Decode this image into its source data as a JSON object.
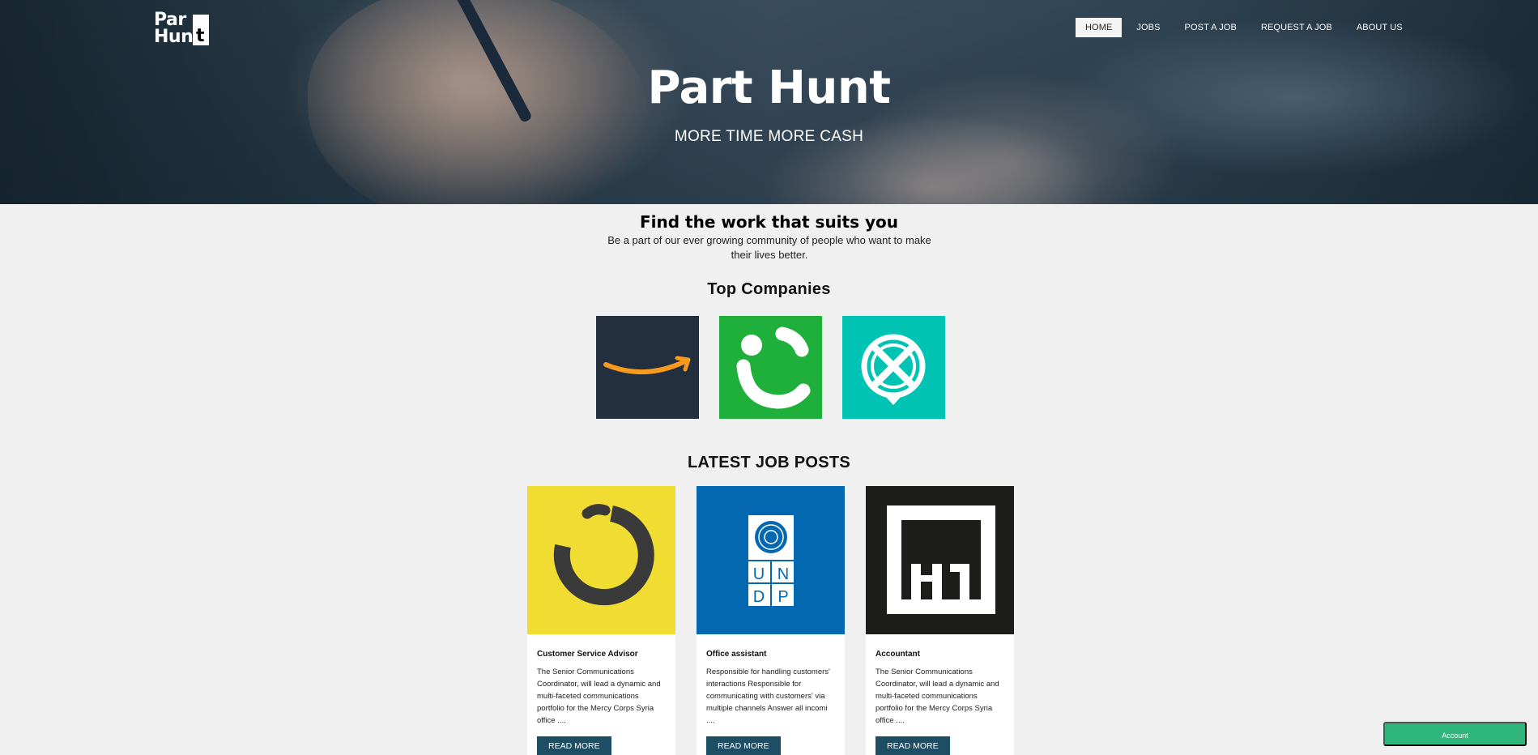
{
  "brand": {
    "logo_line1": "Par",
    "logo_line2": "Hun",
    "logo_t": "t"
  },
  "nav": {
    "items": [
      {
        "label": "HOME",
        "active": true
      },
      {
        "label": "JOBS"
      },
      {
        "label": "POST A JOB"
      },
      {
        "label": "REQUEST A JOB"
      },
      {
        "label": "ABOUT US"
      }
    ]
  },
  "hero": {
    "title": "Part Hunt",
    "subtitle": "MORE TIME MORE CASH"
  },
  "intro": {
    "title": "Find the work that suits you",
    "text": "Be a part of our ever growing community of people who want to make their lives better."
  },
  "top_companies": {
    "title": "Top Companies",
    "items": [
      {
        "icon": "amazon-logo-icon",
        "color": "#232f3e"
      },
      {
        "icon": "careem-logo-icon",
        "color": "#1fb03c"
      },
      {
        "icon": "company-logo-icon",
        "color": "#00c3b3"
      }
    ]
  },
  "latest_jobs": {
    "title": "LATEST JOB POSTS",
    "items": [
      {
        "title": "Customer Service Advisor",
        "description": "The Senior Communications Coordinator, will lead a dynamic and multi-faceted communications portfolio for the Mercy Corps Syria office ....",
        "button": "READ MORE",
        "icon": "noon-logo-icon",
        "color": "#f1dd32"
      },
      {
        "title": "Office assistant",
        "description": "Responsible for handling customers' interactions Responsible for communicating with customers' via multiple channels Answer all incomi ....",
        "button": "READ MORE",
        "icon": "undp-logo-icon",
        "color": "#0468b1"
      },
      {
        "title": "Accountant",
        "description": "The Senior Communications Coordinator, will lead a dynamic and multi-faceted communications portfolio for the Mercy Corps Syria office ....",
        "button": "READ MORE",
        "icon": "h1-logo-icon",
        "color": "#1d1d1b"
      }
    ]
  },
  "account_button": "Account",
  "colors": {
    "button_dark": "#1e4e64",
    "account_green": "#2eb67d",
    "page_bg": "#f0f0f0"
  }
}
